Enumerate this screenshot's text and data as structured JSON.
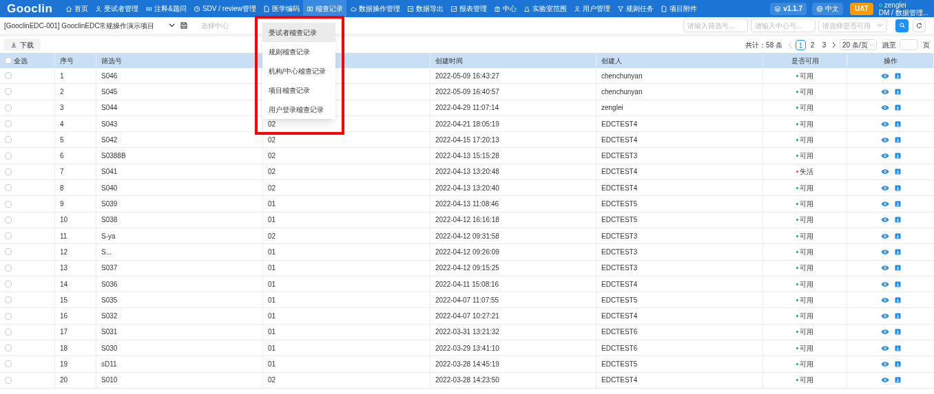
{
  "logo": "Gooclin",
  "nav": [
    {
      "label": "首页",
      "kind": "home",
      "selected": false
    },
    {
      "label": "受试者管理",
      "kind": "person",
      "selected": false
    },
    {
      "label": "注释&题问",
      "kind": "bars",
      "selected": false
    },
    {
      "label": "SDV / review管理",
      "kind": "clock",
      "selected": false
    },
    {
      "label": "医学编码",
      "kind": "doc",
      "selected": false
    },
    {
      "label": "稽查记录",
      "kind": "grid",
      "selected": true
    },
    {
      "label": "数据操作管理",
      "kind": "cloud",
      "selected": false
    },
    {
      "label": "数据导出",
      "kind": "export",
      "selected": false
    },
    {
      "label": "报表管理",
      "kind": "chart",
      "selected": false
    },
    {
      "label": "中心",
      "kind": "bank",
      "selected": false
    },
    {
      "label": "实验室范围",
      "kind": "flask",
      "selected": false
    },
    {
      "label": "用户管理",
      "kind": "person",
      "selected": false
    },
    {
      "label": "规则任务",
      "kind": "filter",
      "selected": false
    },
    {
      "label": "项目附件",
      "kind": "doc",
      "selected": false
    }
  ],
  "version": "v1.1.7",
  "language": "中文",
  "env": "UAT",
  "user": {
    "name": "zenglei",
    "role": "DM / 数据管理..."
  },
  "project": "[GooclinEDC-001]  GooclinEDC常规操作演示项目",
  "center_select": {
    "placeholder": "选择中心"
  },
  "filters": [
    {
      "kind": "input",
      "placeholder": "请输入筛选号..."
    },
    {
      "kind": "input",
      "placeholder": "请输入中心号..."
    },
    {
      "kind": "select",
      "placeholder": "请选择是否可用"
    }
  ],
  "download": "下载",
  "pagination": {
    "total": "共计：58 条",
    "pages": [
      {
        "label": "1",
        "selected": true
      },
      {
        "label": "2",
        "selected": false
      },
      {
        "label": "3",
        "selected": false
      }
    ],
    "page_size": "20 条/页",
    "jump": "跳至",
    "page_unit": "页"
  },
  "dropdown": [
    {
      "label": "受试者稽查记录",
      "selected": true
    },
    {
      "label": "规则稽查记录",
      "selected": false
    },
    {
      "label": "机构/中心稽查记录",
      "selected": false
    },
    {
      "label": "项目稽查记录",
      "selected": false
    },
    {
      "label": "用户登录稽查记录",
      "selected": false
    }
  ],
  "table": {
    "select_all": {
      "label": "全选",
      "checked": false
    },
    "columns": [
      "序号",
      "筛选号",
      "创建时间",
      "创建人",
      "是否可用",
      "操作"
    ],
    "rows": [
      {
        "checked": false,
        "no": "1",
        "screening": "S046",
        "creator_time": "2022-05-09 16:43:27",
        "creator": "chenchunyan",
        "status": "可用",
        "available": true
      },
      {
        "checked": false,
        "no": "2",
        "screening": "S045",
        "creator_time": "2022-05-09 16:40:57",
        "creator": "chenchunyan",
        "status": "可用",
        "available": true
      },
      {
        "checked": false,
        "no": "3",
        "screening": "S044",
        "creator_time": "2022-04-29 11:07:14",
        "creator": "zenglei",
        "status": "可用",
        "available": true
      },
      {
        "checked": false,
        "no": "4",
        "screening": "S043",
        "center": "02",
        "creator_time": "2022-04-21 18:05:19",
        "creator": "EDCTEST4",
        "status": "可用",
        "available": true
      },
      {
        "checked": false,
        "no": "5",
        "screening": "S042",
        "center": "02",
        "creator_time": "2022-04-15 17:20:13",
        "creator": "EDCTEST4",
        "status": "可用",
        "available": true
      },
      {
        "checked": false,
        "no": "6",
        "screening": "S0388B",
        "center": "02",
        "creator_time": "2022-04-13 15:15:28",
        "creator": "EDCTEST3",
        "status": "可用",
        "available": true
      },
      {
        "checked": false,
        "no": "7",
        "screening": "S041",
        "center": "02",
        "creator_time": "2022-04-13 13:20:48",
        "creator": "EDCTEST4",
        "status": "失活",
        "available": false
      },
      {
        "checked": false,
        "no": "8",
        "screening": "S040",
        "center": "02",
        "creator_time": "2022-04-13 13:20:40",
        "creator": "EDCTEST4",
        "status": "可用",
        "available": true
      },
      {
        "checked": false,
        "no": "9",
        "screening": "S039",
        "center": "01",
        "creator_time": "2022-04-13 11:08:46",
        "creator": "EDCTEST5",
        "status": "可用",
        "available": true
      },
      {
        "checked": false,
        "no": "10",
        "screening": "S038",
        "center": "01",
        "creator_time": "2022-04-12 16:16:18",
        "creator": "EDCTEST5",
        "status": "可用",
        "available": true
      },
      {
        "checked": false,
        "no": "11",
        "screening": "S-ya",
        "center": "02",
        "creator_time": "2022-04-12 09:31:58",
        "creator": "EDCTEST3",
        "status": "可用",
        "available": true
      },
      {
        "checked": false,
        "no": "12",
        "screening": "S...",
        "center": "01",
        "creator_time": "2022-04-12 09:26:09",
        "creator": "EDCTEST3",
        "status": "可用",
        "available": true
      },
      {
        "checked": false,
        "no": "13",
        "screening": "S037",
        "center": "01",
        "creator_time": "2022-04-12 09:15:25",
        "creator": "EDCTEST3",
        "status": "可用",
        "available": true
      },
      {
        "checked": false,
        "no": "14",
        "screening": "S036",
        "center": "01",
        "creator_time": "2022-04-11 15:08:16",
        "creator": "EDCTEST4",
        "status": "可用",
        "available": true
      },
      {
        "checked": false,
        "no": "15",
        "screening": "S035",
        "center": "01",
        "creator_time": "2022-04-07 11:07:55",
        "creator": "EDCTEST5",
        "status": "可用",
        "available": true
      },
      {
        "checked": false,
        "no": "16",
        "screening": "S032",
        "center": "01",
        "creator_time": "2022-04-07 10:27:21",
        "creator": "EDCTEST4",
        "status": "可用",
        "available": true
      },
      {
        "checked": false,
        "no": "17",
        "screening": "S031",
        "center": "01",
        "creator_time": "2022-03-31 13:21:32",
        "creator": "EDCTEST6",
        "status": "可用",
        "available": true
      },
      {
        "checked": false,
        "no": "18",
        "screening": "S030",
        "center": "01",
        "creator_time": "2022-03-29 13:41:10",
        "creator": "EDCTEST6",
        "status": "可用",
        "available": true
      },
      {
        "checked": false,
        "no": "19",
        "screening": "sD11",
        "center": "01",
        "creator_time": "2022-03-28 14:45:19",
        "creator": "EDCTEST5",
        "status": "可用",
        "available": true
      },
      {
        "checked": false,
        "no": "20",
        "screening": "S010",
        "center": "02",
        "creator_time": "2022-03-28 14:23:50",
        "creator": "EDCTEST4",
        "status": "可用",
        "available": true
      }
    ]
  }
}
